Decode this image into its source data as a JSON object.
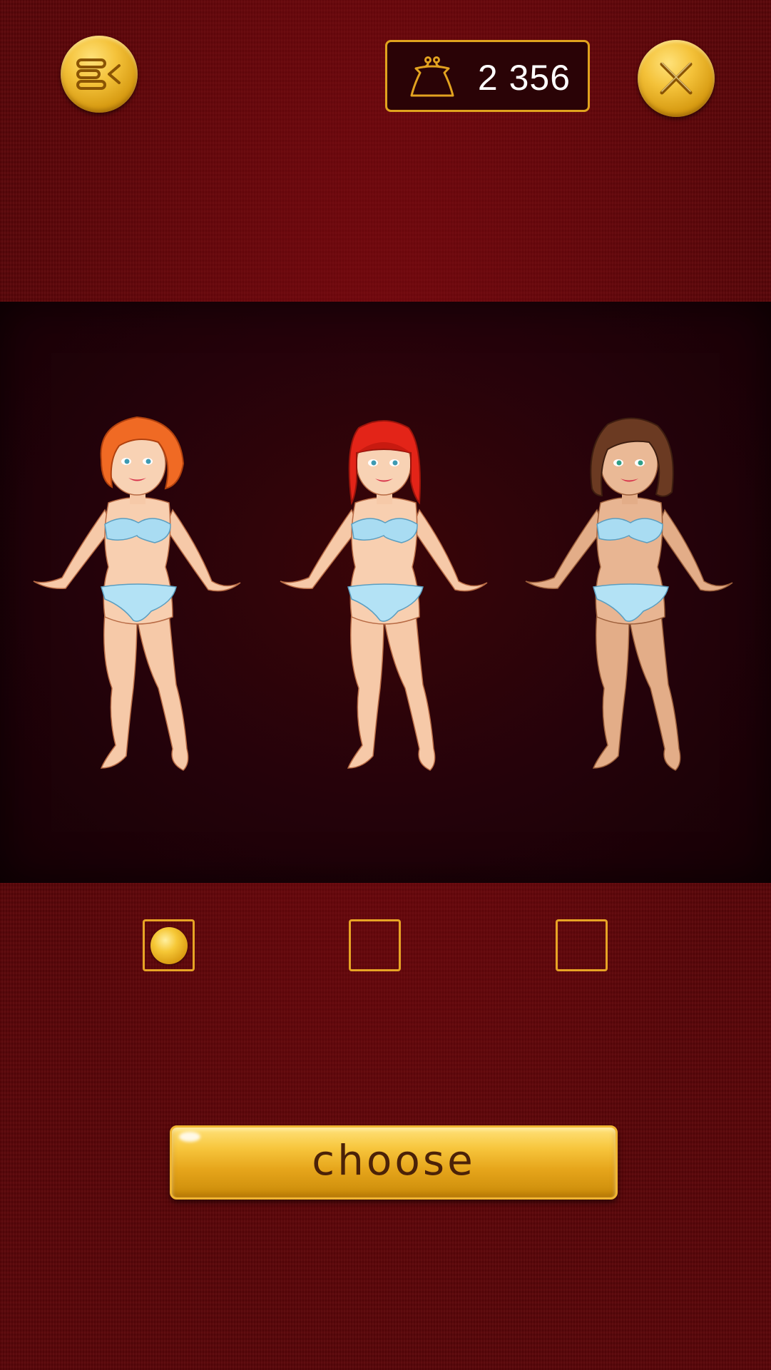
{
  "header": {
    "menu_icon": "menu-collapse-icon",
    "wallet": {
      "icon": "purse-icon",
      "amount": "2 356"
    },
    "close_icon": "close-icon"
  },
  "characters": [
    {
      "hair": "orange-bob",
      "selected": true
    },
    {
      "hair": "red-straight",
      "selected": false
    },
    {
      "hair": "brown-bob",
      "selected": false
    }
  ],
  "choose_button": {
    "label": "choose"
  },
  "colors": {
    "background": "#5a0508",
    "panel": "#24020a",
    "gold": "#e7a425",
    "button_text": "#4b2208"
  }
}
